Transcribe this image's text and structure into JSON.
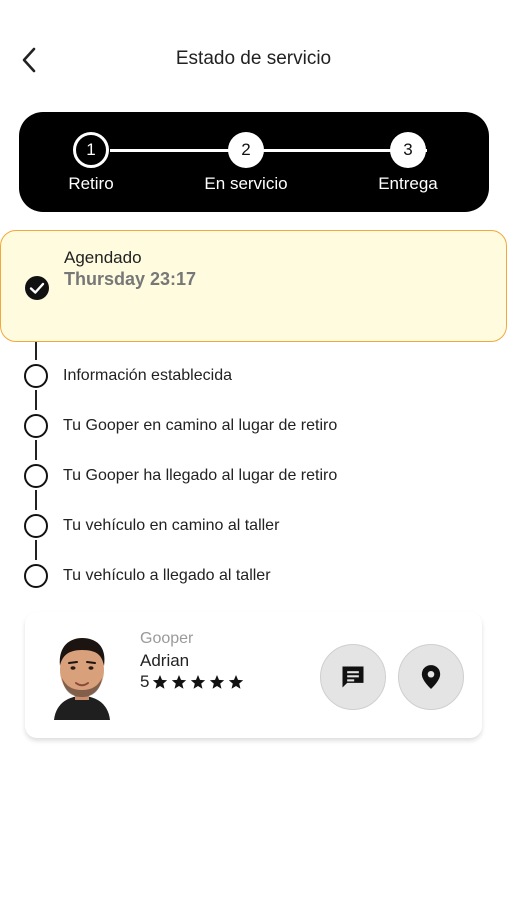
{
  "header": {
    "title": "Estado de servicio",
    "back_icon": "chevron-left-icon"
  },
  "stepper": {
    "steps": [
      {
        "number": "1",
        "label": "Retiro",
        "state": "active"
      },
      {
        "number": "2",
        "label": "En servicio",
        "state": "inactive"
      },
      {
        "number": "3",
        "label": "Entrega",
        "state": "inactive"
      }
    ]
  },
  "current_status": {
    "label": "Agendado",
    "time": "Thursday 23:17",
    "icon": "check-circle-icon",
    "background": "#fffbdf",
    "border_color": "#f2a93b"
  },
  "timeline": {
    "items": [
      "Información establecida",
      "Tu Gooper en camino al lugar de retiro",
      "Tu Gooper ha llegado al lugar de retiro",
      "Tu vehículo en camino al taller",
      "Tu vehículo a llegado al taller"
    ]
  },
  "gooper_card": {
    "role": "Gooper",
    "name": "Adrian",
    "rating": "5",
    "stars": 5,
    "chat_icon": "chat-icon",
    "location_icon": "location-pin-icon"
  }
}
